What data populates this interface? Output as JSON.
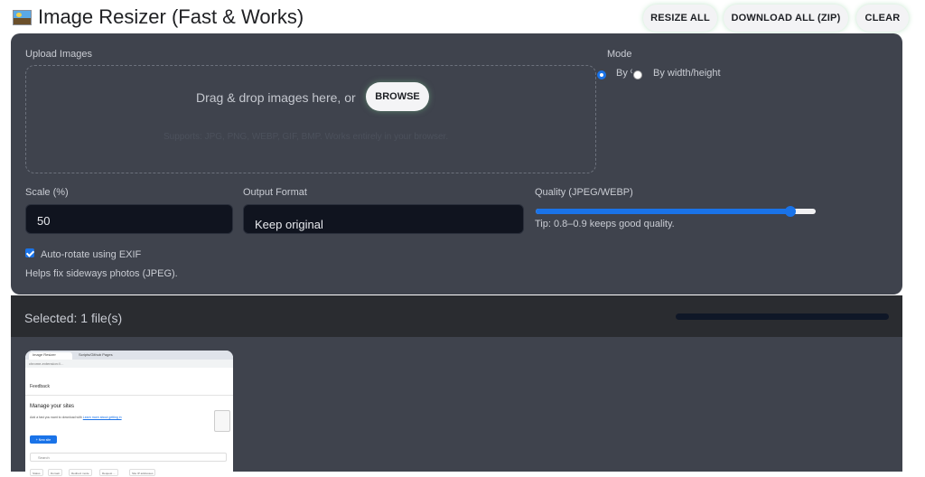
{
  "header": {
    "title": "Image Resizer (Fast & Works)",
    "icon": "picture-frame-icon",
    "resize_all_label": "RESIZE ALL",
    "download_zip_label": "DOWNLOAD ALL (ZIP)",
    "clear_label": "CLEAR"
  },
  "upload": {
    "label": "Upload Images",
    "drop_text": "Drag & drop images here, or",
    "browse_label": "BROWSE",
    "hint": "Supports: JPG, PNG, WEBP, GIF, BMP. Works entirely in your browser."
  },
  "mode": {
    "label": "Mode",
    "options": [
      "By %",
      "By width/height"
    ],
    "selected": "By %"
  },
  "scale": {
    "label": "Scale (%)",
    "value": "50"
  },
  "format": {
    "label": "Output Format",
    "value": "Keep original"
  },
  "quality": {
    "label": "Quality (JPEG/WEBP)",
    "value": 0.92,
    "min": 0.1,
    "max": 1,
    "tip": "Tip: 0.8–0.9 keeps good quality."
  },
  "exif": {
    "label": "Auto-rotate using EXIF",
    "checked": true,
    "help": "Helps fix sideways photos (JPEG)."
  },
  "selection": {
    "text": "Selected: 1 file(s)",
    "progress": 0
  },
  "thumbnail": {
    "tabs": [
      "Image Resizer",
      "Scripts/Github Pages"
    ],
    "url": "chrome-extension://...",
    "feedback": "Feedback",
    "heading": "Manage your sites",
    "para": "Add a fast you want to download with  ",
    "link": "Learn more about getting in",
    "button": "+ New site",
    "search": "Search",
    "chips": [
      "Status",
      "Domain",
      "Redirect mode",
      "Request ...",
      "Site IP addresses"
    ]
  },
  "colors": {
    "panel_bg": "#3f434d",
    "input_bg": "#10141f",
    "accent": "#1a73e8",
    "bar_bg": "#2a2c30"
  }
}
